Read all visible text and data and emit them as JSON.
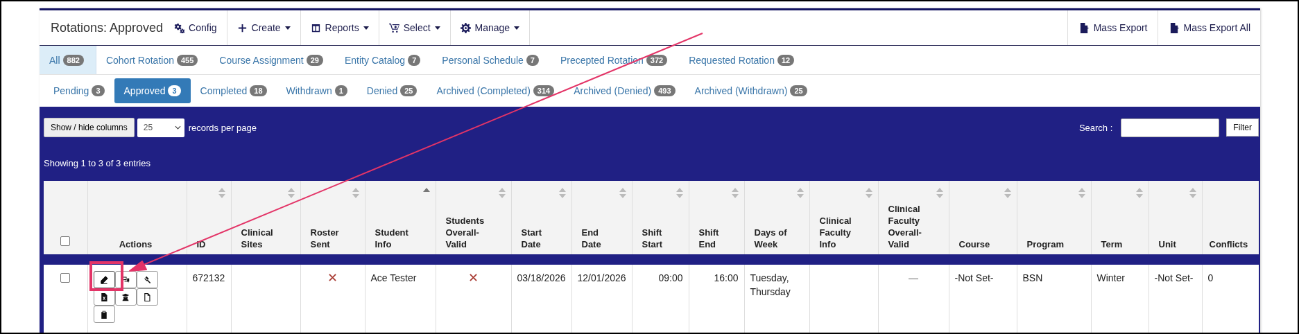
{
  "header": {
    "title": "Rotations: Approved",
    "menu": [
      {
        "label": "Config",
        "dropdown": false
      },
      {
        "label": "Create",
        "dropdown": true
      },
      {
        "label": "Reports",
        "dropdown": true
      },
      {
        "label": "Select",
        "dropdown": true
      },
      {
        "label": "Manage",
        "dropdown": true
      }
    ],
    "exports": [
      {
        "label": "Mass Export"
      },
      {
        "label": "Mass Export All"
      }
    ]
  },
  "category_tabs": [
    {
      "label": "All",
      "count": "882",
      "selected": true
    },
    {
      "label": "Cohort Rotation",
      "count": "455",
      "selected": false
    },
    {
      "label": "Course Assignment",
      "count": "29",
      "selected": false
    },
    {
      "label": "Entity Catalog",
      "count": "7",
      "selected": false
    },
    {
      "label": "Personal Schedule",
      "count": "7",
      "selected": false
    },
    {
      "label": "Precepted Rotation",
      "count": "372",
      "selected": false
    },
    {
      "label": "Requested Rotation",
      "count": "12",
      "selected": false
    }
  ],
  "status_tabs": [
    {
      "label": "Pending",
      "count": "3",
      "selected": false
    },
    {
      "label": "Approved",
      "count": "3",
      "selected": true
    },
    {
      "label": "Completed",
      "count": "18",
      "selected": false
    },
    {
      "label": "Withdrawn",
      "count": "1",
      "selected": false
    },
    {
      "label": "Denied",
      "count": "25",
      "selected": false
    },
    {
      "label": "Archived (Completed)",
      "count": "314",
      "selected": false
    },
    {
      "label": "Archived (Denied)",
      "count": "493",
      "selected": false
    },
    {
      "label": "Archived (Withdrawn)",
      "count": "25",
      "selected": false
    }
  ],
  "toolbar": {
    "columns_button": "Show / hide columns",
    "page_size": "25",
    "page_size_label": "records per page",
    "search_label": "Search :",
    "filter_button": "Filter"
  },
  "info": "Showing 1 to 3 of 3 entries",
  "table": {
    "select_all_checked": false,
    "columns": [
      {
        "label": "Actions",
        "sortable": false
      },
      {
        "label": "ID",
        "sortable": true,
        "sorted": false
      },
      {
        "label": "Clinical Sites",
        "sortable": true,
        "sorted": false
      },
      {
        "label": "Roster Sent",
        "sortable": true,
        "sorted": false
      },
      {
        "label": "Student Info",
        "sortable": true,
        "sorted": true
      },
      {
        "label": "Students Overall-Valid",
        "sortable": true,
        "sorted": false
      },
      {
        "label": "Start Date",
        "sortable": true,
        "sorted": false
      },
      {
        "label": "End Date",
        "sortable": true,
        "sorted": false
      },
      {
        "label": "Shift Start",
        "sortable": true,
        "sorted": false
      },
      {
        "label": "Shift End",
        "sortable": true,
        "sorted": false
      },
      {
        "label": "Days of Week",
        "sortable": true,
        "sorted": false
      },
      {
        "label": "Clinical Faculty Info",
        "sortable": true,
        "sorted": false
      },
      {
        "label": "Clinical Faculty Overall-Valid",
        "sortable": true,
        "sorted": false
      },
      {
        "label": "Course",
        "sortable": true,
        "sorted": false
      },
      {
        "label": "Program",
        "sortable": true,
        "sorted": false
      },
      {
        "label": "Term",
        "sortable": true,
        "sorted": false
      },
      {
        "label": "Unit",
        "sortable": true,
        "sorted": false
      },
      {
        "label": "Conflicts",
        "sortable": false
      }
    ],
    "rows": [
      {
        "checked": false,
        "cells": [
          {
            "kind": "actions",
            "buttons": [
              {
                "kind": "edit",
                "highlighted": true
              },
              {
                "kind": "chat",
                "highlighted": false
              },
              {
                "kind": "gavel",
                "highlighted": false
              },
              {
                "kind": "excel",
                "highlighted": false
              },
              {
                "kind": "graduate",
                "highlighted": false
              },
              {
                "kind": "file",
                "highlighted": false
              },
              {
                "kind": "clipboard",
                "highlighted": false
              }
            ]
          },
          {
            "kind": "text",
            "text": "672132"
          },
          {
            "kind": "text",
            "text": ""
          },
          {
            "kind": "cross"
          },
          {
            "kind": "text",
            "text": "Ace Tester"
          },
          {
            "kind": "cross"
          },
          {
            "kind": "text",
            "text": "03/18/2026"
          },
          {
            "kind": "text",
            "text": "12/01/2026"
          },
          {
            "kind": "time",
            "text": "09:00"
          },
          {
            "kind": "time",
            "text": "16:00"
          },
          {
            "kind": "text",
            "text": "Tuesday, Thursday"
          },
          {
            "kind": "text",
            "text": ""
          },
          {
            "kind": "dash",
            "text": "—"
          },
          {
            "kind": "text",
            "text": "-Not Set-"
          },
          {
            "kind": "text",
            "text": "BSN"
          },
          {
            "kind": "text",
            "text": "Winter"
          },
          {
            "kind": "text",
            "text": "-Not Set-"
          },
          {
            "kind": "text",
            "text": "0"
          }
        ]
      }
    ]
  }
}
